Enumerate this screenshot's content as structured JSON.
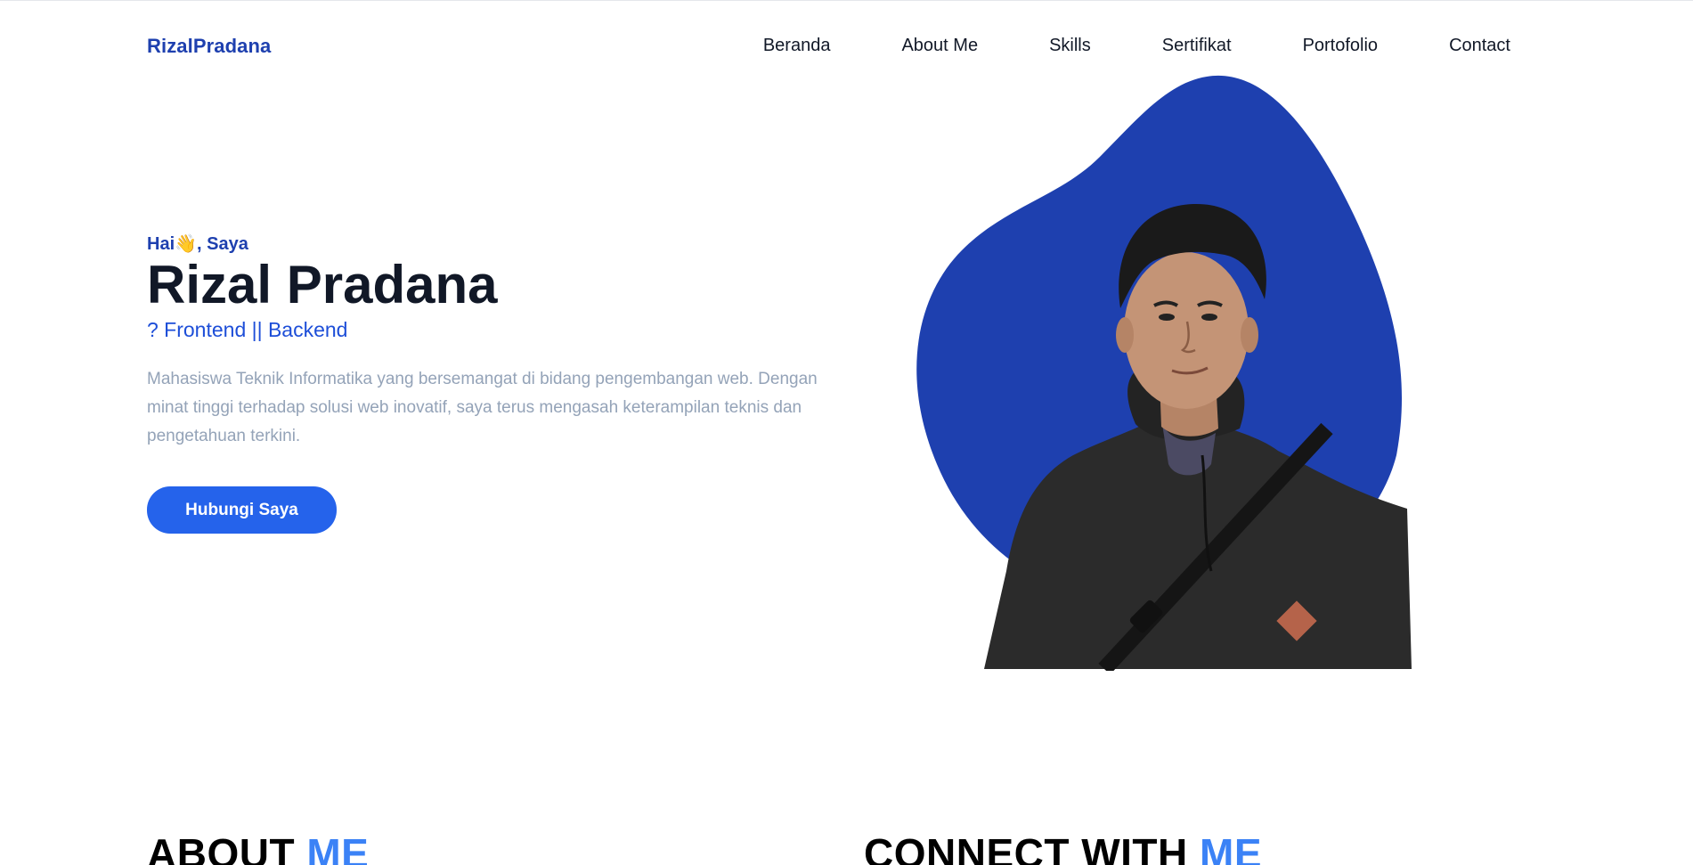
{
  "brand": "RizalPradana",
  "nav": {
    "items": [
      "Beranda",
      "About Me",
      "Skills",
      "Sertifikat",
      "Portofolio",
      "Contact"
    ]
  },
  "hero": {
    "greeting": "Hai👋, Saya",
    "name": "Rizal Pradana",
    "role": "? Frontend || Backend",
    "description": "Mahasiswa Teknik Informatika yang bersemangat di bidang pengembangan web. Dengan minat tinggi terhadap solusi web inovatif, saya terus mengasah keterampilan teknis dan pengetahuan terkini.",
    "cta_label": "Hubungi Saya"
  },
  "sections": {
    "about": {
      "title_main": "ABOUT",
      "title_accent": "ME"
    },
    "connect": {
      "title_main": "CONNECT WITH",
      "title_accent": "ME"
    }
  },
  "colors": {
    "brand": "#1e40af",
    "accent": "#3b82f6",
    "button": "#2563eb",
    "blob": "#1e40af",
    "text_dark": "#111827",
    "text_muted": "#94a3b8"
  },
  "icons": {
    "profile_photo": "person-photo"
  }
}
